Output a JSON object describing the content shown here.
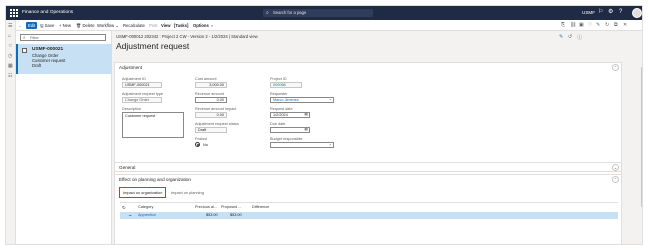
{
  "topbar": {
    "app_title": "Finance and Operations",
    "search_placeholder": "Search for a page",
    "company": "USMF"
  },
  "actionbar": {
    "edit": "Edit",
    "save": "Save",
    "new": "+ New",
    "delete": "Delete",
    "workflow": "Workflow",
    "recalculate": "Recalculate",
    "post": "Post",
    "view": "View",
    "tasks": "[Tasks]",
    "options": "Options"
  },
  "listpane": {
    "filter_placeholder": "Filter",
    "item": {
      "id": "USMF-000021",
      "line2": "Change Order",
      "line3": "Customer request",
      "line4": "Draft"
    }
  },
  "header": {
    "breadcrumb": "USMF-000012 202342 : Project 2 CW - Version 2 - 1/2/2024  |  Standard view",
    "title": "Adjustment request"
  },
  "adjustment": {
    "section_title": "Adjustment",
    "fields": {
      "adjustment_id_label": "Adjustment ID",
      "adjustment_id": "USMF-000021",
      "request_type_label": "Adjustment request type",
      "request_type": "Change Order",
      "description_label": "Description",
      "description": "Customer request",
      "cost_amount_label": "Cost amount",
      "cost_amount": "3,000.00",
      "revenue_amount_label": "Revenue amount",
      "revenue_amount": "0.00",
      "revenue_impact_label": "Revenue amount impact",
      "revenue_impact": "0.00",
      "status_label": "Adjustment request status",
      "status": "Draft",
      "posted_label": "Posted",
      "posted": "No",
      "project_id_label": "Project ID",
      "project_id": "000068",
      "requester_label": "Requester",
      "requester": "Marco Jiménez",
      "request_date_label": "Request date",
      "request_date": "1/2/2024",
      "due_date_label": "Due date",
      "due_date": "",
      "budget_resp_label": "Budget responsible",
      "budget_resp": ""
    }
  },
  "general": {
    "section_title": "General"
  },
  "effect": {
    "section_title": "Effect on planning and organization",
    "tabs": [
      "Impact on organization",
      "Impact on planning"
    ],
    "grid": {
      "headers": [
        "Category",
        "Previous al...",
        "Proposed ...",
        "Difference"
      ],
      "rows": [
        {
          "category": "Apprentice",
          "previous": "$53.00",
          "proposed": "$53.00",
          "difference": ""
        }
      ]
    }
  },
  "colors": {
    "topbar": "#1f2a44",
    "accent": "#0f6cbd",
    "selected_row": "#c7e0f4",
    "highlight_box": "#d13438"
  }
}
